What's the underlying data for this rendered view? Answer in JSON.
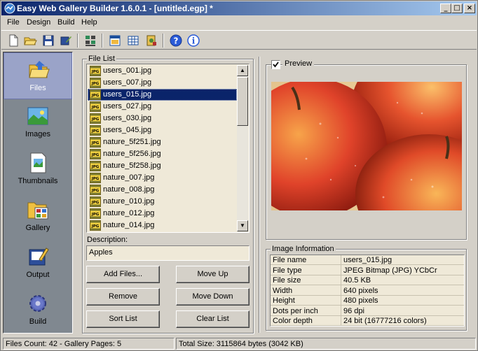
{
  "window": {
    "title": "Easy Web Gallery Builder 1.6.0.1 - [untitled.egp] *",
    "minimize": "_",
    "maximize": "□",
    "close": "×"
  },
  "menu": [
    "File",
    "Design",
    "Build",
    "Help"
  ],
  "toolbar": [
    "new-file-icon",
    "open-folder-icon",
    "save-icon",
    "save-as-icon",
    "build-gallery-icon",
    "window-icon",
    "grid-icon",
    "settings-icon",
    "help-icon",
    "info-icon"
  ],
  "sidebar": {
    "items": [
      {
        "label": "Files",
        "icon": "files-folder-icon",
        "active": true
      },
      {
        "label": "Images",
        "icon": "images-icon",
        "active": false
      },
      {
        "label": "Thumbnails",
        "icon": "thumbnails-icon",
        "active": false
      },
      {
        "label": "Gallery",
        "icon": "gallery-icon",
        "active": false
      },
      {
        "label": "Output",
        "icon": "output-icon",
        "active": false
      },
      {
        "label": "Build",
        "icon": "build-gear-icon",
        "active": false
      }
    ]
  },
  "file_list": {
    "title": "File List",
    "icon_label": "JPG",
    "files": [
      "users_001.jpg",
      "users_007.jpg",
      "users_015.jpg",
      "users_027.jpg",
      "users_030.jpg",
      "users_045.jpg",
      "nature_5f251.jpg",
      "nature_5f256.jpg",
      "nature_5f258.jpg",
      "nature_007.jpg",
      "nature_008.jpg",
      "nature_010.jpg",
      "nature_012.jpg",
      "nature_014.jpg"
    ],
    "selected": "users_015.jpg"
  },
  "description": {
    "label": "Description:",
    "value": "Apples"
  },
  "buttons": {
    "add_files": "Add Files...",
    "move_up": "Move Up",
    "remove": "Remove",
    "move_down": "Move Down",
    "sort_list": "Sort List",
    "clear_list": "Clear List"
  },
  "preview": {
    "label": "Preview",
    "checked": true
  },
  "image_info": {
    "title": "Image Information",
    "rows": [
      {
        "key": "File name",
        "value": "users_015.jpg"
      },
      {
        "key": "File type",
        "value": "JPEG Bitmap (JPG) YCbCr"
      },
      {
        "key": "File size",
        "value": "40.5 KB"
      },
      {
        "key": "Width",
        "value": "640 pixels"
      },
      {
        "key": "Height",
        "value": "480 pixels"
      },
      {
        "key": "Dots per inch",
        "value": "96 dpi"
      },
      {
        "key": "Color depth",
        "value": "24 bit (16777216 colors)"
      }
    ]
  },
  "status": {
    "left": "Files Count: 42 - Gallery Pages: 5",
    "right": "Total Size: 3115864 bytes (3042 KB)"
  },
  "colors": {
    "title_start": "#0a246a",
    "title_end": "#a6caf0",
    "selection": "#0a246a",
    "list_bg": "#efe9d8",
    "sidebar_bg": "#808890"
  }
}
